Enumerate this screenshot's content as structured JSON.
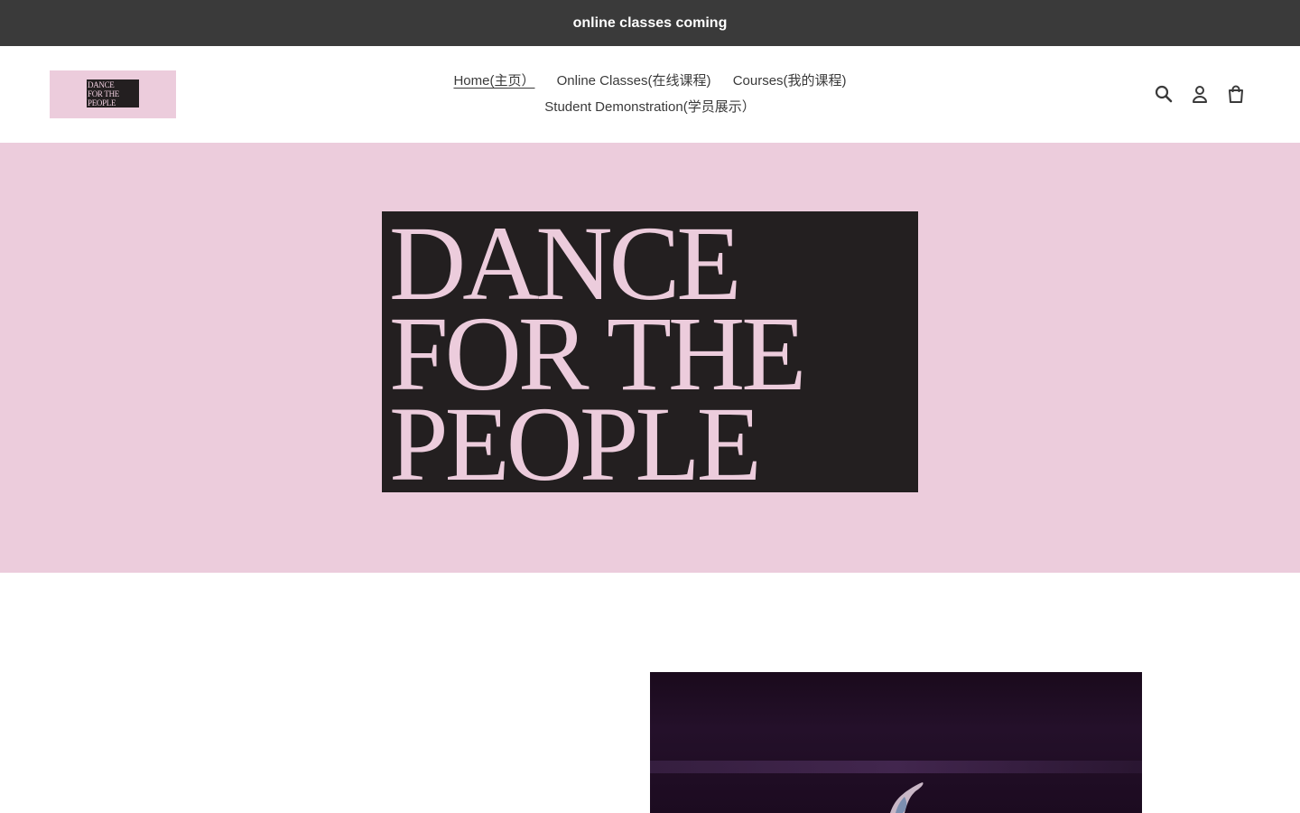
{
  "announcement": {
    "text": "online classes coming"
  },
  "header": {
    "logo_text": "DANCE\nFOR THE\nPEOPLE",
    "nav": [
      {
        "label": "Home(主页）",
        "active": true
      },
      {
        "label": "Online Classes(在线课程)",
        "active": false
      },
      {
        "label": "Courses(我的课程)",
        "active": false
      },
      {
        "label": "Student Demonstration(学员展示）",
        "active": false
      }
    ],
    "icons": [
      "search-icon",
      "account-icon",
      "cart-icon"
    ]
  },
  "hero": {
    "logo_text": "DANCE\nFOR THE\nPEOPLE"
  },
  "colors": {
    "announcement_bg": "#3a3a3a",
    "brand_pink": "#ecccdc",
    "logo_black": "#231f20",
    "text": "#3a3a3a"
  }
}
